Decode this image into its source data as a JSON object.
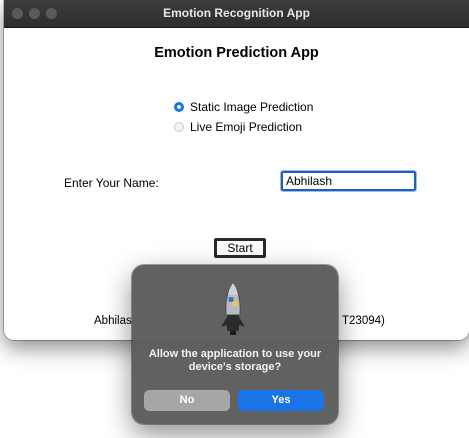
{
  "window": {
    "title": "Emotion Recognition App"
  },
  "main": {
    "heading": "Emotion Prediction App",
    "radio_options": [
      {
        "label": "Static Image Prediction",
        "selected": true
      },
      {
        "label": "Live Emoji Prediction",
        "selected": false
      }
    ],
    "name_label": "Enter Your Name:",
    "name_value": "Abhilash",
    "start_label": "Start",
    "footer_left": "Abhilas",
    "footer_right": "T23094)"
  },
  "dialog": {
    "icon": "python-rocket-icon",
    "message": "Allow the application to use your device's storage?",
    "no_label": "No",
    "yes_label": "Yes"
  },
  "colors": {
    "accent": "#1a74e8",
    "titlebar": "#333333",
    "dialog_bg": "#5c5c5c"
  }
}
